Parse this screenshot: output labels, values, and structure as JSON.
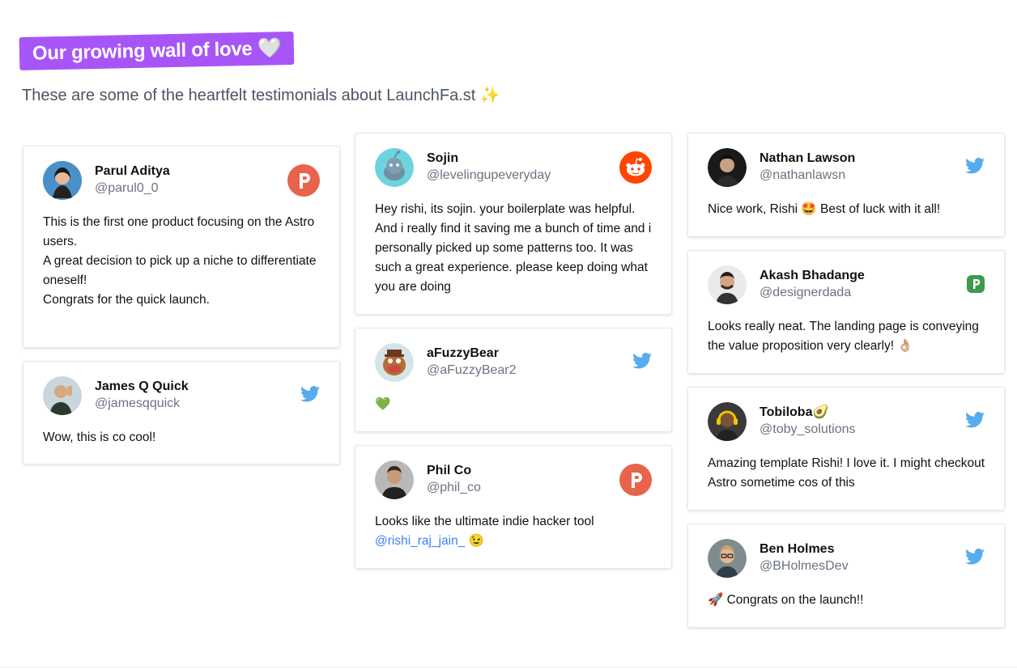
{
  "header": {
    "title": "Our growing wall of love 🤍",
    "subtitle": "These are some of the heartfelt testimonials about LaunchFa.st ✨"
  },
  "colors": {
    "badge": "#a855f7",
    "twitter": "#55acee",
    "producthunt": "#e8634c",
    "reddit": "#ff4500",
    "peerlist": "#3d9a50",
    "link": "#3b82f6"
  },
  "columns": [
    {
      "cards": [
        {
          "name": "Parul Aditya",
          "handle": "@parul0_0",
          "source": "producthunt-icon",
          "lines": [
            "This is the first one product focusing on the Astro users.",
            "A great decision to pick up a niche to differentiate oneself!",
            "Congrats for the quick launch."
          ]
        },
        {
          "name": "James Q Quick",
          "handle": "@jamesqquick",
          "source": "twitter-icon",
          "lines": [
            "Wow, this is co cool!"
          ]
        }
      ]
    },
    {
      "cards": [
        {
          "name": "Sojin",
          "handle": "@levelingupeveryday",
          "source": "reddit-icon",
          "lines": [
            "Hey rishi, its sojin. your boilerplate was helpful. And i really find it saving me a bunch of time and i personally picked up some patterns too. It was such a great experience. please keep doing what you are doing"
          ]
        },
        {
          "name": "aFuzzyBear",
          "handle": "@aFuzzyBear2",
          "source": "twitter-icon",
          "lines": [
            "💚"
          ]
        },
        {
          "name": "Phil Co",
          "handle": "@phil_co",
          "source": "producthunt-icon",
          "lines": [
            "Looks like the ultimate indie hacker tool"
          ],
          "mention": "@rishi_raj_jain_",
          "mention_suffix": " 😉"
        }
      ]
    },
    {
      "cards": [
        {
          "name": "Nathan Lawson",
          "handle": "@nathanlawsn",
          "source": "twitter-icon",
          "lines": [
            "Nice work, Rishi 🤩 Best of luck with it all!"
          ]
        },
        {
          "name": "Akash Bhadange",
          "handle": "@designerdada",
          "source": "peerlist-icon",
          "lines": [
            "Looks really neat. The landing page is conveying the value proposition very clearly! 👌🏼"
          ]
        },
        {
          "name": "Tobiloba🥑",
          "handle": "@toby_solutions",
          "source": "twitter-icon",
          "lines": [
            "Amazing template Rishi! I love it. I might checkout Astro sometime cos of this"
          ]
        },
        {
          "name": "Ben Holmes",
          "handle": "@BHolmesDev",
          "source": "twitter-icon",
          "lines": [
            "🚀 Congrats on the launch!!"
          ]
        }
      ]
    }
  ]
}
